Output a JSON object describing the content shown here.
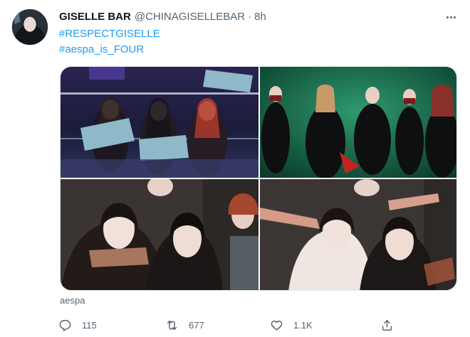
{
  "tweet": {
    "display_name": "GISELLE BAR",
    "handle": "@CHINAGISELLEBAR",
    "separator": "·",
    "time": "8h",
    "hashtags": [
      "#RESPECTGISELLE",
      "#aespa_is_FOUR"
    ],
    "media_caption": "aespa",
    "media_label_left": "aespa",
    "colors": {
      "link": "#1d9bf0",
      "secondary_text": "#536471",
      "primary_text": "#0f1419"
    }
  },
  "actions": {
    "reply": {
      "icon": "reply-icon",
      "count": "115"
    },
    "retweet": {
      "icon": "retweet-icon",
      "count": "677"
    },
    "like": {
      "icon": "heart-icon",
      "count": "1.1K"
    },
    "share": {
      "icon": "share-icon"
    }
  },
  "menu": {
    "icon": "more-options-icon"
  }
}
